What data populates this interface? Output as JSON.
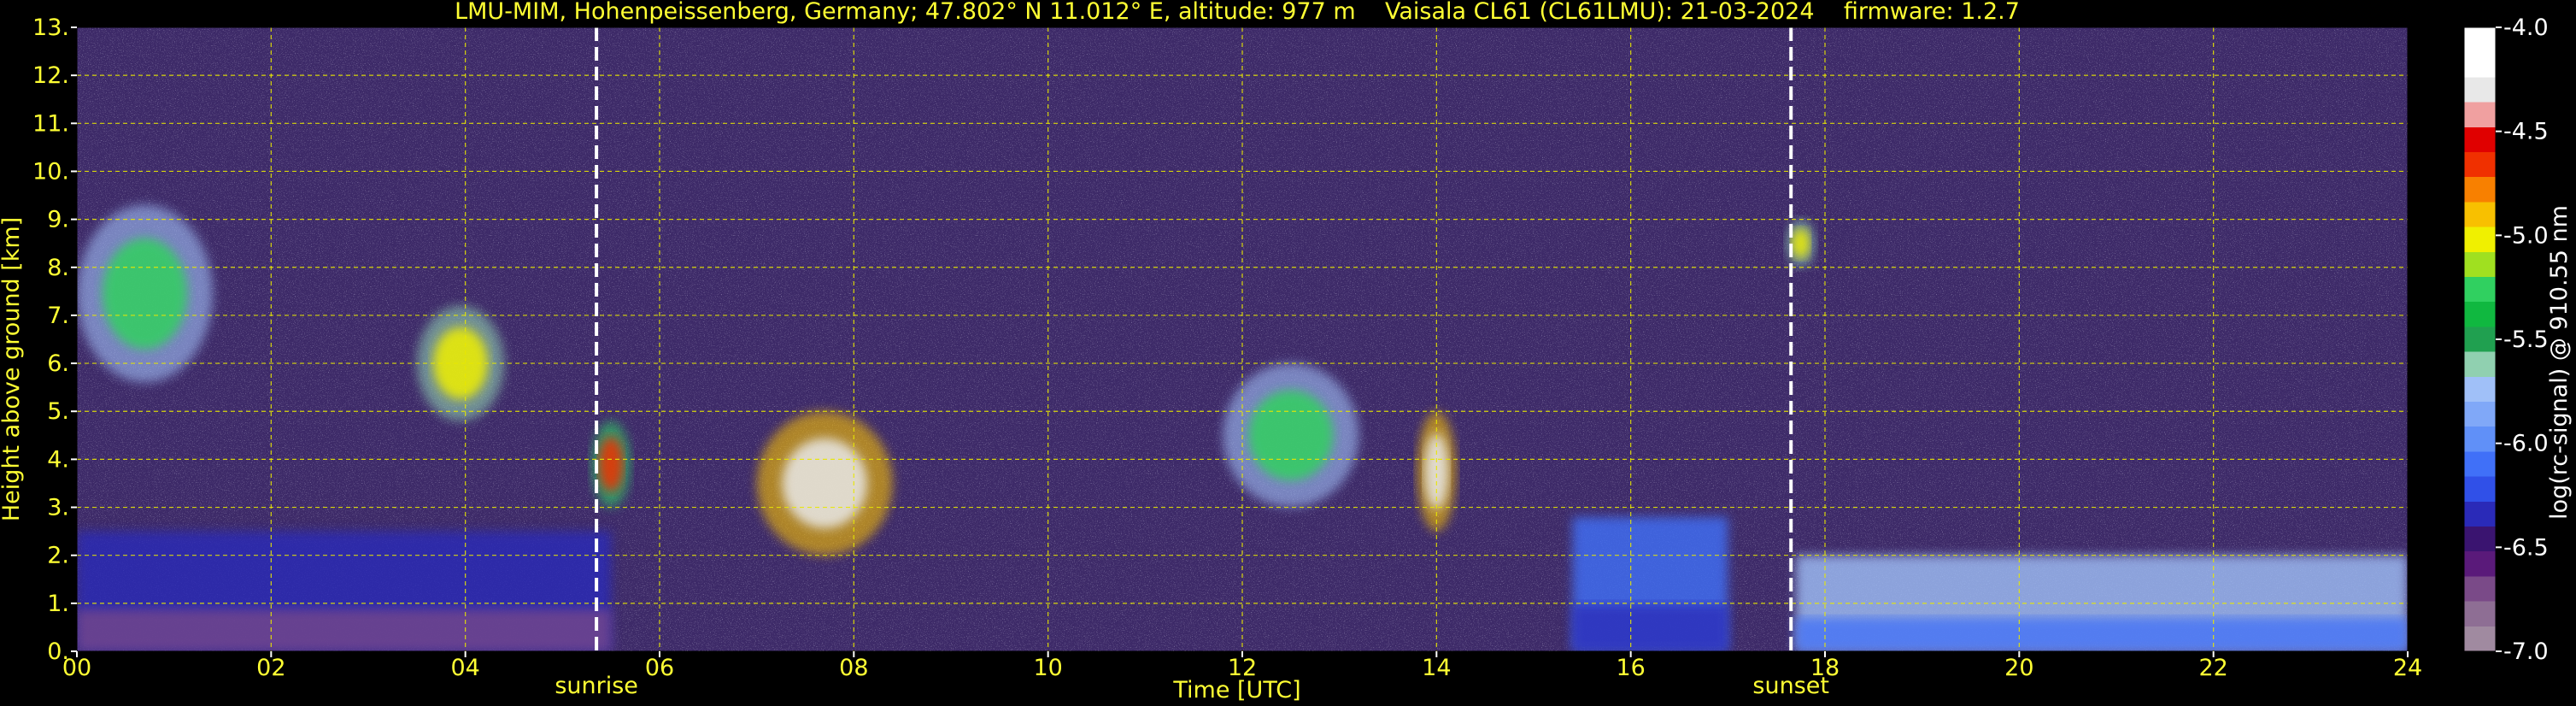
{
  "chart_data": {
    "type": "heatmap",
    "title": "LMU-MIM, Hohenpeissenberg, Germany; 47.802° N 11.012° E, altitude: 977 m    Vaisala CL61 (CL61LMU): 21-03-2024    firmware: 1.2.7",
    "xlabel": "Time [UTC]",
    "ylabel": "Height above ground [km]",
    "xlim": [
      0,
      24
    ],
    "ylim": [
      0,
      13
    ],
    "x_ticks": [
      0,
      2,
      4,
      6,
      8,
      10,
      12,
      14,
      16,
      18,
      20,
      22,
      24
    ],
    "x_tick_labels": [
      "00",
      "02",
      "04",
      "06",
      "08",
      "10",
      "12",
      "14",
      "16",
      "18",
      "20",
      "22",
      "24"
    ],
    "y_ticks": [
      0,
      1,
      2,
      3,
      4,
      5,
      6,
      7,
      8,
      9,
      10,
      11,
      12,
      13
    ],
    "y_tick_labels": [
      "0.",
      "1.",
      "2.",
      "3.",
      "4.",
      "5.",
      "6.",
      "7.",
      "8.",
      "9.",
      "10.",
      "11.",
      "12.",
      "13."
    ],
    "grid": true,
    "annotations": [
      {
        "label": "sunrise",
        "x": 5.35
      },
      {
        "label": "sunset",
        "x": 17.65
      }
    ],
    "colorbar": {
      "label": "log(rc-signal) @ 910.55 nm",
      "range": [
        -7.0,
        -4.0
      ],
      "ticks": [
        -4.0,
        -4.5,
        -5.0,
        -5.5,
        -6.0,
        -6.5,
        -7.0
      ],
      "tick_labels": [
        "-4.0",
        "-4.5",
        "-5.0",
        "-5.5",
        "-6.0",
        "-6.5",
        "-7.0"
      ],
      "colors": [
        "#a08aa0",
        "#8e6e94",
        "#7a4a88",
        "#5a1a7a",
        "#3a1470",
        "#2a2ab8",
        "#3050e8",
        "#4070f8",
        "#6090f8",
        "#80a8f8",
        "#a0c0f8",
        "#90d0b0",
        "#20a050",
        "#10b840",
        "#30d060",
        "#a0e020",
        "#f0f000",
        "#f8c000",
        "#f88000",
        "#f03000",
        "#e00000",
        "#f0a0a0",
        "#e8e8e8",
        "#ffffff",
        "#ffffff"
      ]
    },
    "features": [
      {
        "type": "cloud",
        "x": [
          0.0,
          1.4
        ],
        "y": [
          5.6,
          9.3
        ],
        "level": -5.2
      },
      {
        "type": "cloud",
        "x": [
          3.5,
          4.4
        ],
        "y": [
          4.8,
          7.2
        ],
        "level": -5.0
      },
      {
        "type": "cloud",
        "x": [
          5.3,
          5.7
        ],
        "y": [
          3.0,
          4.8
        ],
        "level": -4.6
      },
      {
        "type": "cloud",
        "x": [
          7.0,
          8.4
        ],
        "y": [
          2.0,
          5.0
        ],
        "level": -4.3
      },
      {
        "type": "cloud",
        "x": [
          11.8,
          13.2
        ],
        "y": [
          3.0,
          6.0
        ],
        "level": -5.2
      },
      {
        "type": "cloud",
        "x": [
          13.8,
          14.2
        ],
        "y": [
          2.5,
          5.0
        ],
        "level": -4.3
      },
      {
        "type": "cloud",
        "x": [
          17.6,
          17.9
        ],
        "y": [
          8.0,
          9.0
        ],
        "level": -5.0
      },
      {
        "type": "boundary-layer",
        "x": [
          0.0,
          5.5
        ],
        "y": [
          0.0,
          2.5
        ],
        "level": -6.4
      },
      {
        "type": "boundary-layer",
        "x": [
          15.4,
          17.0
        ],
        "y": [
          0.0,
          2.8
        ],
        "level": -6.1
      },
      {
        "type": "boundary-layer",
        "x": [
          17.7,
          24.0
        ],
        "y": [
          0.0,
          2.0
        ],
        "level": -5.8
      }
    ]
  }
}
